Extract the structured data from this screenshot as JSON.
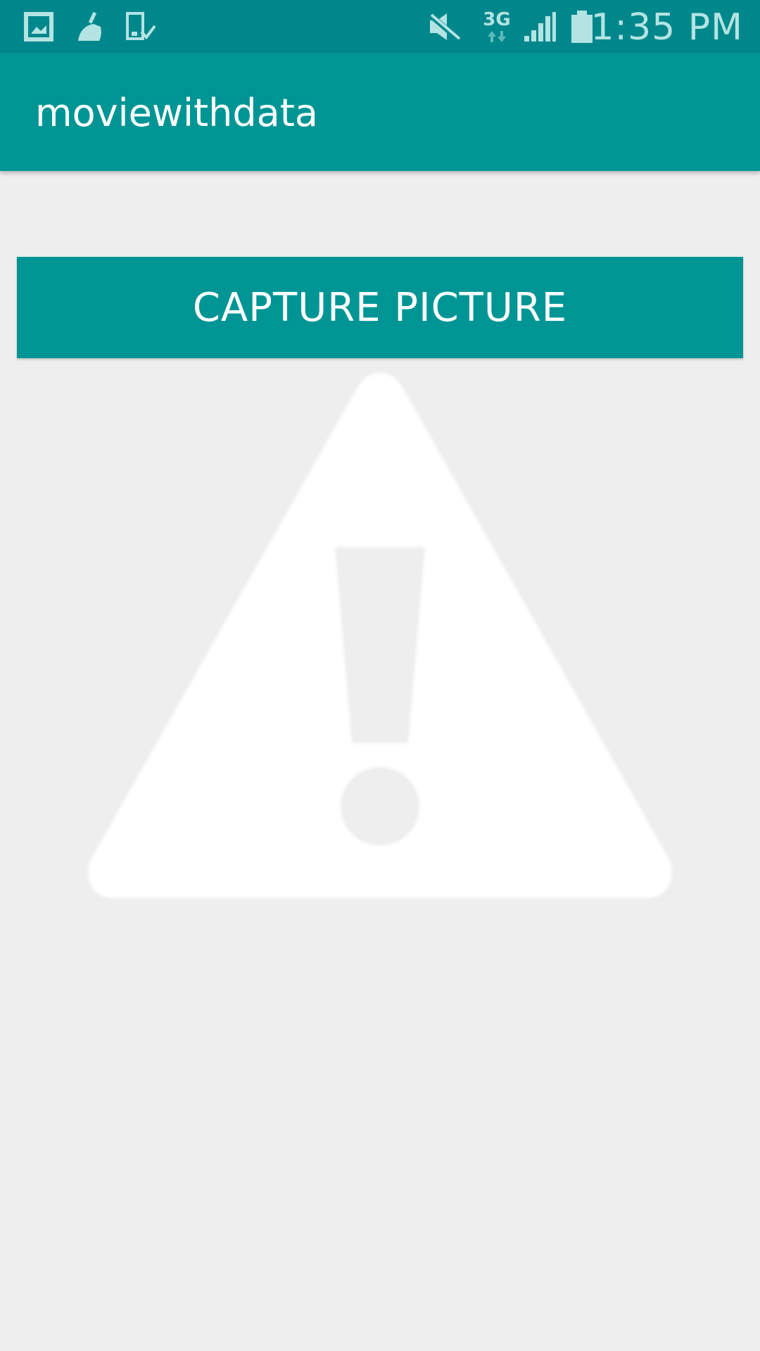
{
  "status_bar": {
    "time": "1:35 PM",
    "network": "3G",
    "icons": [
      "gallery-icon",
      "cleaner-icon",
      "device-check-icon",
      "mute-icon",
      "network-3g-icon",
      "signal-icon",
      "battery-icon"
    ]
  },
  "app_bar": {
    "title": "moviewithdata"
  },
  "main": {
    "capture_button_label": "CAPTURE PICTURE",
    "image_placeholder_icon": "warning-icon"
  },
  "colors": {
    "status_bar": "#00878b",
    "app_bar": "#009595",
    "button": "#009595",
    "background": "#eeeeee",
    "icon_tint": "#b3e3e3"
  }
}
